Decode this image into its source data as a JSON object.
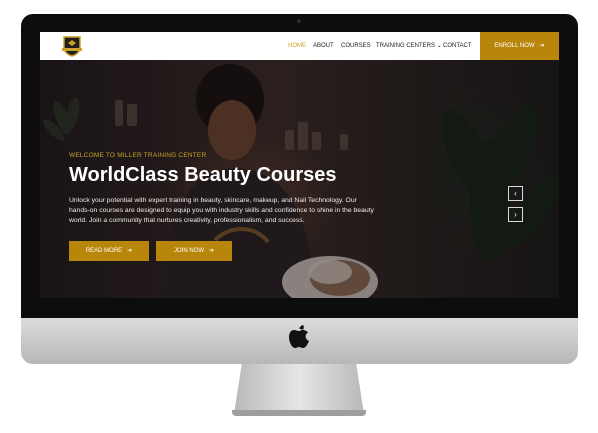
{
  "nav": {
    "items": [
      {
        "label": "HOME",
        "active": true
      },
      {
        "label": "ABOUT"
      },
      {
        "label": "COURSES"
      },
      {
        "label": "TRAINING CENTERS",
        "dropdown": true
      },
      {
        "label": "CONTACT"
      }
    ],
    "cta_label": "ENROLL NOW",
    "logo_icon": "shield-crest-icon"
  },
  "hero": {
    "eyebrow": "WELCOME TO MILLER TRAINING CENTER",
    "title": "WorldClass Beauty Courses",
    "description": "Unlock your potential with expert training in beauty, skincare, makeup, and Nail Technology. Our hands-on courses are designed to equip you with industry skills and confidence to shine in the beauty world. Join a community that nurtures creativity, professionalism, and success.",
    "primary_button": "READ MORE",
    "secondary_button": "JOIN NOW",
    "carousel_prev_icon": "chevron-left-icon",
    "carousel_next_icon": "chevron-right-icon"
  },
  "colors": {
    "accent": "#b8860b",
    "accent_text": "#c9a227",
    "nav_background": "#ffffff",
    "hero_overlay": "#1a1414"
  },
  "device": {
    "frame": "imac",
    "logo_icon": "apple-logo-icon"
  }
}
